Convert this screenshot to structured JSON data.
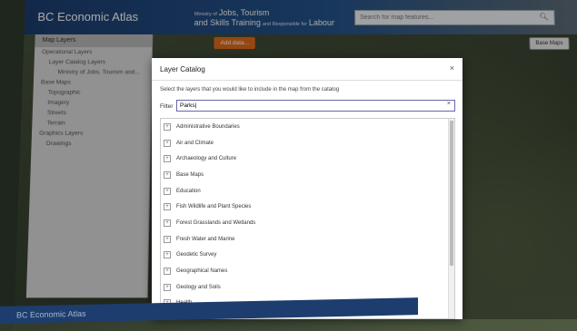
{
  "header": {
    "brand": "BC Economic Atlas",
    "ministry_small": "Ministry of",
    "ministry_line1": "Jobs, Tourism",
    "ministry_line2": "and Skills Training",
    "ministry_small2": "and Responsible for",
    "ministry_line3": "Labour",
    "search_placeholder": "Search for map features..."
  },
  "left_panel": {
    "title": "Map Layers",
    "items": [
      "Operational Layers",
      "Layer Catalog Layers",
      "Ministry of Jobs, Tourism and...",
      "Base Maps",
      "Topographic",
      "Imagery",
      "Streets",
      "Terrain",
      "Graphics Layers",
      "Drawings"
    ]
  },
  "toolbar": {
    "add_data": "Add data...",
    "base_maps": "Base Maps"
  },
  "dialog": {
    "title": "Layer Catalog",
    "close": "×",
    "description": "Select the layers that you would like to include in the map from the catalog",
    "filter_label": "Filter",
    "filter_value": "Parks|",
    "filter_clear": "×",
    "items": [
      "Administrative Boundaries",
      "Air and Climate",
      "Archaeology and Culture",
      "Base Maps",
      "Education",
      "Fish Wildlife and Plant Species",
      "Forest Grasslands and Wetlands",
      "Fresh Water and Marine",
      "Geodetic Survey",
      "Geographical Names",
      "Geology and Soils",
      "Health"
    ]
  },
  "lower_tab": {
    "brand": "BC Economic Atlas"
  },
  "colors": {
    "header": "#1c3d6e",
    "accent": "#e06a1a"
  }
}
